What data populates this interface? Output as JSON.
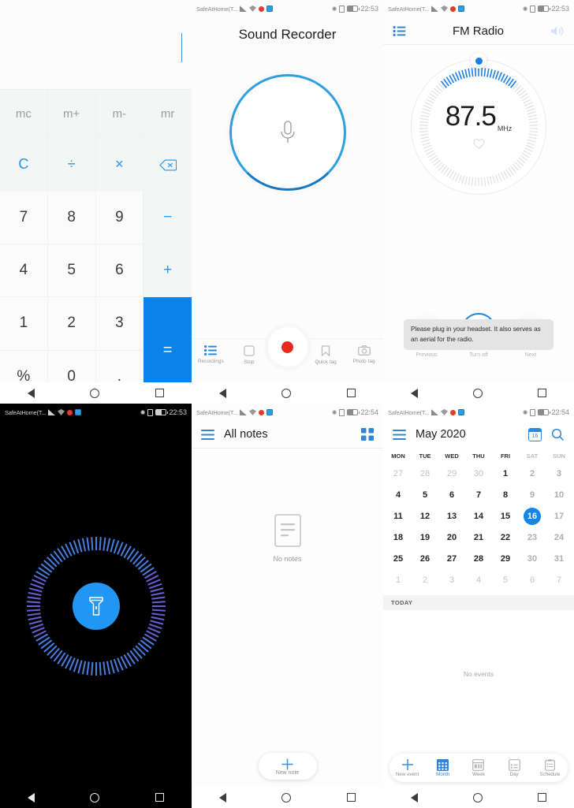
{
  "status_bar": {
    "carrier": "SafeAtHome(T...",
    "time_2253": "22:53",
    "time_2254": "22:54"
  },
  "calculator": {
    "name": "Calculator",
    "display_value": "",
    "memory_keys": [
      "mc",
      "m+",
      "m-",
      "mr"
    ],
    "function_keys": [
      "C",
      "÷",
      "×"
    ],
    "backspace_label": "backspace",
    "rows": [
      [
        "7",
        "8",
        "9",
        "−"
      ],
      [
        "4",
        "5",
        "6",
        "+"
      ],
      [
        "1",
        "2",
        "3",
        "="
      ],
      [
        "%",
        "0",
        "."
      ]
    ],
    "equals_label": "=",
    "minus_label": "−",
    "plus_label": "+",
    "accent_color": "#0a84ea",
    "op_color": "#2196f3"
  },
  "sound_recorder": {
    "title": "Sound Recorder",
    "mic_icon": "microphone-icon",
    "toolbar": [
      {
        "label": "Recordings",
        "icon": "list-icon"
      },
      {
        "label": "Stop",
        "icon": "stop-square-icon"
      },
      {
        "label": "Quick tag",
        "icon": "bookmark-icon"
      },
      {
        "label": "Photo tag",
        "icon": "camera-icon"
      }
    ],
    "record_button": "record-button",
    "ring_color": "#2f9fe0",
    "record_dot_color": "#e8291c"
  },
  "fm_radio": {
    "title": "FM Radio",
    "menu_icon": "list-icon",
    "speaker_icon": "speaker-icon",
    "frequency": "87.5",
    "unit": "MHz",
    "favorite_icon": "heart-icon",
    "toast": "Please plug in your headset. It also serves as an aerial for the radio.",
    "controls": [
      {
        "label": "Previous",
        "icon": "chevron-left-icon"
      },
      {
        "label": "Turn off",
        "icon": "power-icon"
      },
      {
        "label": "Next",
        "icon": "chevron-right-icon"
      }
    ],
    "accent_color": "#1a7ee8"
  },
  "flashlight": {
    "name": "Flashlight",
    "icon": "flashlight-icon",
    "button_color": "#2196f3",
    "background": "#000000"
  },
  "notes": {
    "title": "All notes",
    "menu_icon": "hamburger-icon",
    "grid_icon": "grid-view-icon",
    "empty_icon": "document-icon",
    "empty_label": "No notes",
    "new_note_label": "New note",
    "accent_color": "#2f86d8"
  },
  "calendar": {
    "title": "May 2020",
    "menu_icon": "hamburger-icon",
    "today_icon": "calendar-badge-icon",
    "today_badge_number": "16",
    "search_icon": "search-icon",
    "day_headers": [
      "MON",
      "TUE",
      "WED",
      "THU",
      "FRI",
      "SAT",
      "SUN"
    ],
    "weeks": [
      [
        {
          "d": "27",
          "dim": true
        },
        {
          "d": "28",
          "dim": true
        },
        {
          "d": "29",
          "dim": true
        },
        {
          "d": "30",
          "dim": true
        },
        {
          "d": "1"
        },
        {
          "d": "2",
          "we": true
        },
        {
          "d": "3",
          "we": true
        }
      ],
      [
        {
          "d": "4"
        },
        {
          "d": "5"
        },
        {
          "d": "6"
        },
        {
          "d": "7"
        },
        {
          "d": "8"
        },
        {
          "d": "9",
          "we": true
        },
        {
          "d": "10",
          "we": true
        }
      ],
      [
        {
          "d": "11"
        },
        {
          "d": "12"
        },
        {
          "d": "13"
        },
        {
          "d": "14"
        },
        {
          "d": "15"
        },
        {
          "d": "16",
          "sel": true
        },
        {
          "d": "17",
          "we": true
        }
      ],
      [
        {
          "d": "18"
        },
        {
          "d": "19"
        },
        {
          "d": "20"
        },
        {
          "d": "21"
        },
        {
          "d": "22"
        },
        {
          "d": "23",
          "we": true
        },
        {
          "d": "24",
          "we": true
        }
      ],
      [
        {
          "d": "25"
        },
        {
          "d": "26"
        },
        {
          "d": "27"
        },
        {
          "d": "28"
        },
        {
          "d": "29"
        },
        {
          "d": "30",
          "we": true
        },
        {
          "d": "31",
          "we": true
        }
      ],
      [
        {
          "d": "1",
          "dim": true
        },
        {
          "d": "2",
          "dim": true
        },
        {
          "d": "3",
          "dim": true
        },
        {
          "d": "4",
          "dim": true
        },
        {
          "d": "5",
          "dim": true
        },
        {
          "d": "6",
          "dim": true
        },
        {
          "d": "7",
          "dim": true
        }
      ]
    ],
    "today_header": "TODAY",
    "no_events": "No events",
    "bottom_nav": [
      {
        "label": "New event",
        "icon": "plus-icon",
        "active": false
      },
      {
        "label": "Month",
        "icon": "month-grid-icon",
        "active": true
      },
      {
        "label": "Week",
        "icon": "week-icon",
        "active": false
      },
      {
        "label": "Day",
        "icon": "day-icon",
        "active": false
      },
      {
        "label": "Schedule",
        "icon": "schedule-icon",
        "active": false
      }
    ],
    "selected_color": "#1287e8"
  },
  "nav_bar": {
    "back": "back-button",
    "home": "home-button",
    "recents": "recents-button"
  }
}
